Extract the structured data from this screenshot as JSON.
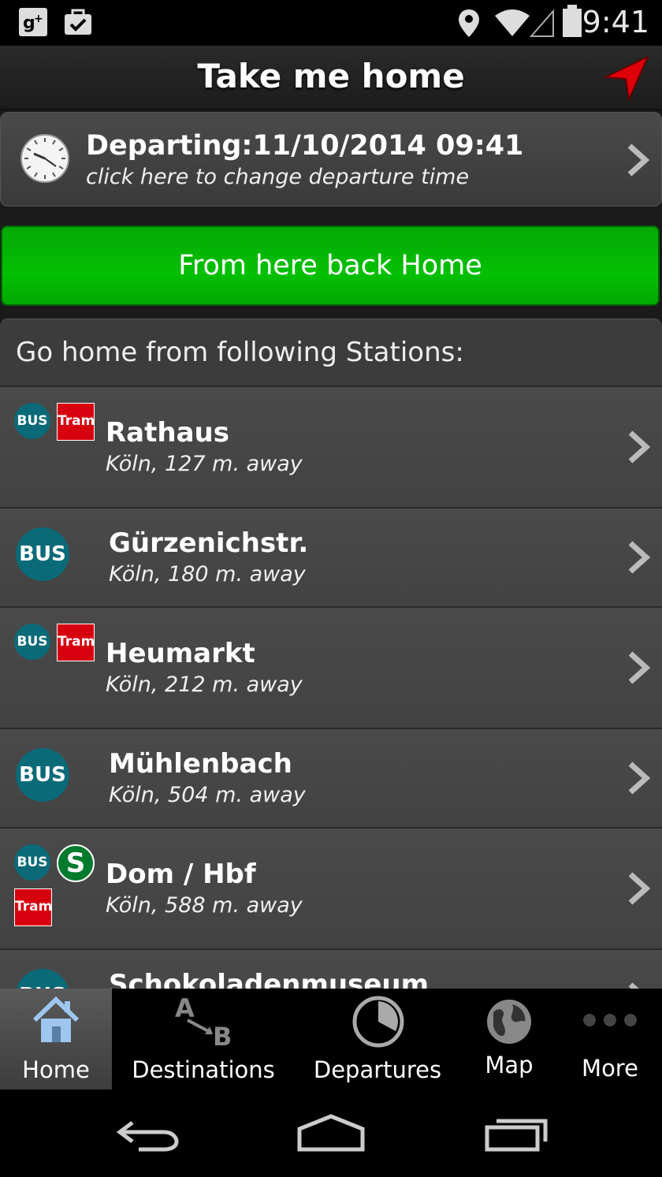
{
  "status_bar": {
    "time": "9:41"
  },
  "app_bar": {
    "title": "Take me home"
  },
  "departure": {
    "title": "Departing:11/10/2014 09:41",
    "subtitle": "click here to change departure time"
  },
  "home_button": {
    "label": "From here back Home"
  },
  "stations": {
    "header": "Go home from following Stations:",
    "items": [
      {
        "name": "Rathaus",
        "distance": "Köln, 127 m. away",
        "modes": [
          "BUS",
          "Tram"
        ]
      },
      {
        "name": "Gürzenichstr.",
        "distance": "Köln, 180 m. away",
        "modes": [
          "BUS"
        ]
      },
      {
        "name": "Heumarkt",
        "distance": "Köln, 212 m. away",
        "modes": [
          "BUS",
          "Tram"
        ]
      },
      {
        "name": "Mühlenbach",
        "distance": "Köln, 504 m. away",
        "modes": [
          "BUS"
        ]
      },
      {
        "name": "Dom / Hbf",
        "distance": "Köln, 588 m. away",
        "modes": [
          "BUS",
          "S",
          "Tram"
        ]
      },
      {
        "name": "Schokoladenmuseum",
        "distance": "",
        "modes": [
          "BUS"
        ]
      }
    ]
  },
  "badges": {
    "bus": "BUS",
    "tram": "Tram",
    "s": "S"
  },
  "tabs": [
    {
      "label": "Home",
      "icon": "house-icon",
      "active": true
    },
    {
      "label": "Destinations",
      "icon": "a-to-b-icon"
    },
    {
      "label": "Departures",
      "icon": "pie-clock-icon"
    },
    {
      "label": "Map",
      "icon": "globe-icon"
    },
    {
      "label": "More",
      "icon": "dots-icon"
    }
  ],
  "colors": {
    "green": "#04b404",
    "bus_teal": "#0b6a78",
    "tram_red": "#d7000f",
    "s_green": "#007a2c",
    "locate_red": "#e0000a"
  }
}
